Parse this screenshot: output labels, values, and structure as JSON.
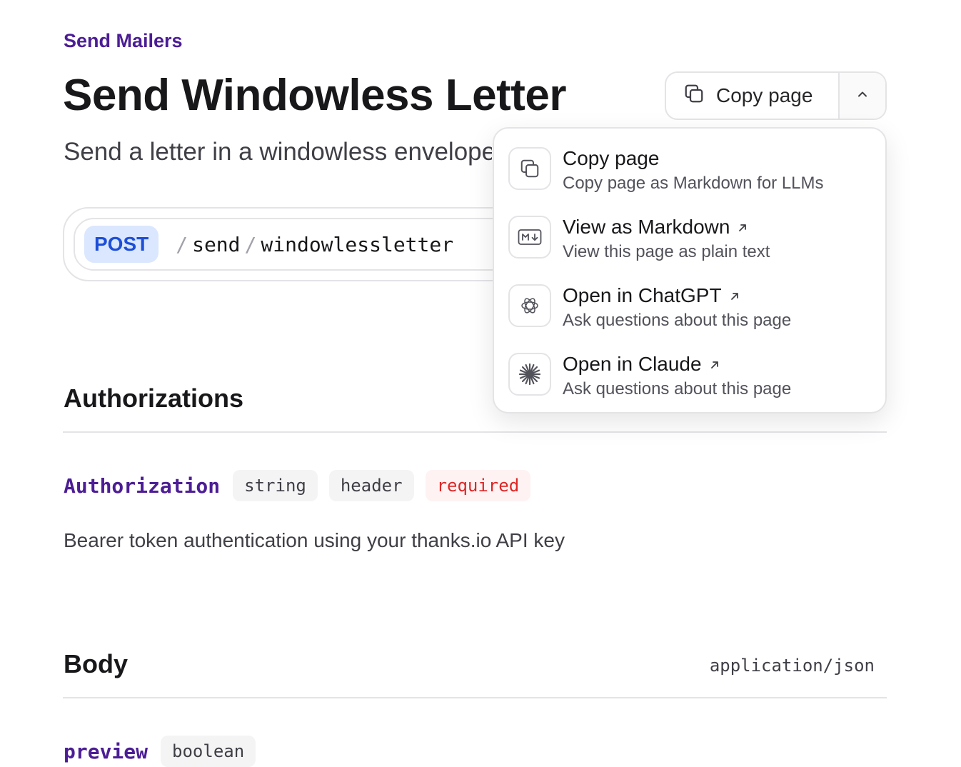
{
  "breadcrumb": "Send Mailers",
  "page": {
    "title": "Send Windowless Letter",
    "subtitle": "Send a letter in a windowless envelope"
  },
  "copy_button": {
    "label": "Copy page",
    "icon": "copy-icon",
    "toggle_icon": "chevron-up-icon"
  },
  "endpoint": {
    "method": "POST",
    "path_segments": [
      "send",
      "windowlessletter"
    ]
  },
  "dropdown": {
    "items": [
      {
        "title": "Copy page",
        "subtitle": "Copy page as Markdown for LLMs",
        "icon": "copy-icon",
        "external": false
      },
      {
        "title": "View as Markdown",
        "subtitle": "View this page as plain text",
        "icon": "markdown-icon",
        "external": true
      },
      {
        "title": "Open in ChatGPT",
        "subtitle": "Ask questions about this page",
        "icon": "chatgpt-icon",
        "external": true
      },
      {
        "title": "Open in Claude",
        "subtitle": "Ask questions about this page",
        "icon": "claude-icon",
        "external": true
      }
    ]
  },
  "authorizations": {
    "title": "Authorizations",
    "param": {
      "name": "Authorization",
      "type": "string",
      "location": "header",
      "required": "required",
      "description": "Bearer token authentication using your thanks.io API key"
    }
  },
  "body": {
    "title": "Body",
    "content_type": "application/json",
    "param": {
      "name": "preview",
      "type": "boolean"
    }
  },
  "colors": {
    "accent": "#4c1d95",
    "method_bg": "#dbe7fe",
    "method_text": "#1d4ed8",
    "required_bg": "#fef2f2",
    "required_text": "#dc2626"
  }
}
